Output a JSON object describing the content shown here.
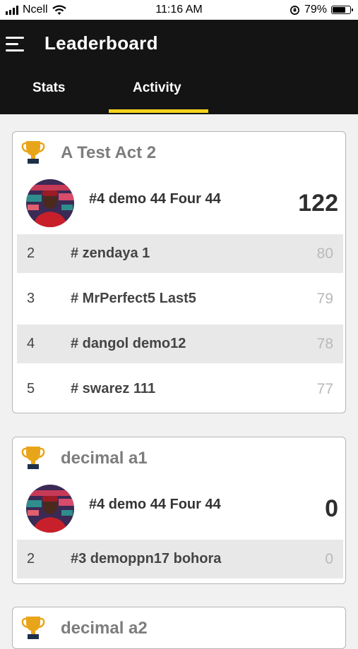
{
  "status_bar": {
    "carrier": "Ncell",
    "time": "11:16 AM",
    "battery": "79%",
    "battery_level": 0.79
  },
  "header": {
    "title": "Leaderboard"
  },
  "tabs": [
    {
      "label": "Stats"
    },
    {
      "label": "Activity",
      "active": true
    }
  ],
  "accent_color": "#f2d31b",
  "cards": [
    {
      "title": "A Test Act 2",
      "leader": {
        "name": "#4 demo 44 Four 44",
        "score": "122"
      },
      "rows": [
        {
          "rank": "2",
          "name": "# zendaya 1",
          "score": "80"
        },
        {
          "rank": "3",
          "name": "# MrPerfect5 Last5",
          "score": "79"
        },
        {
          "rank": "4",
          "name": "# dangol demo12",
          "score": "78"
        },
        {
          "rank": "5",
          "name": "# swarez 111",
          "score": "77"
        }
      ]
    },
    {
      "title": "decimal a1",
      "leader": {
        "name": "#4 demo 44 Four 44",
        "score": "0"
      },
      "rows": [
        {
          "rank": "2",
          "name": "#3 demoppn17 bohora",
          "score": "0"
        }
      ]
    },
    {
      "title": "decimal a2"
    }
  ]
}
